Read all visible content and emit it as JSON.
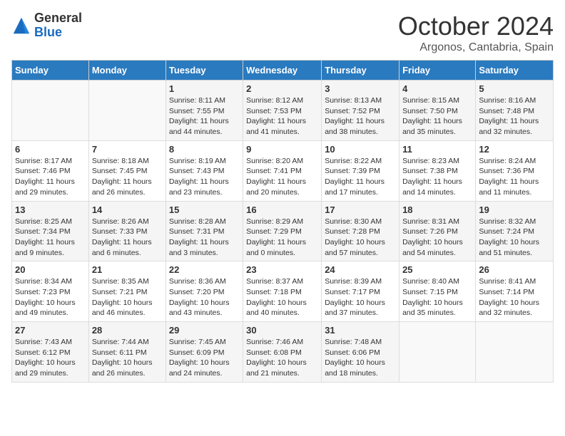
{
  "logo": {
    "general": "General",
    "blue": "Blue"
  },
  "title": "October 2024",
  "location": "Argonos, Cantabria, Spain",
  "days_of_week": [
    "Sunday",
    "Monday",
    "Tuesday",
    "Wednesday",
    "Thursday",
    "Friday",
    "Saturday"
  ],
  "weeks": [
    [
      {
        "day": "",
        "info": ""
      },
      {
        "day": "",
        "info": ""
      },
      {
        "day": "1",
        "info": "Sunrise: 8:11 AM\nSunset: 7:55 PM\nDaylight: 11 hours and 44 minutes."
      },
      {
        "day": "2",
        "info": "Sunrise: 8:12 AM\nSunset: 7:53 PM\nDaylight: 11 hours and 41 minutes."
      },
      {
        "day": "3",
        "info": "Sunrise: 8:13 AM\nSunset: 7:52 PM\nDaylight: 11 hours and 38 minutes."
      },
      {
        "day": "4",
        "info": "Sunrise: 8:15 AM\nSunset: 7:50 PM\nDaylight: 11 hours and 35 minutes."
      },
      {
        "day": "5",
        "info": "Sunrise: 8:16 AM\nSunset: 7:48 PM\nDaylight: 11 hours and 32 minutes."
      }
    ],
    [
      {
        "day": "6",
        "info": "Sunrise: 8:17 AM\nSunset: 7:46 PM\nDaylight: 11 hours and 29 minutes."
      },
      {
        "day": "7",
        "info": "Sunrise: 8:18 AM\nSunset: 7:45 PM\nDaylight: 11 hours and 26 minutes."
      },
      {
        "day": "8",
        "info": "Sunrise: 8:19 AM\nSunset: 7:43 PM\nDaylight: 11 hours and 23 minutes."
      },
      {
        "day": "9",
        "info": "Sunrise: 8:20 AM\nSunset: 7:41 PM\nDaylight: 11 hours and 20 minutes."
      },
      {
        "day": "10",
        "info": "Sunrise: 8:22 AM\nSunset: 7:39 PM\nDaylight: 11 hours and 17 minutes."
      },
      {
        "day": "11",
        "info": "Sunrise: 8:23 AM\nSunset: 7:38 PM\nDaylight: 11 hours and 14 minutes."
      },
      {
        "day": "12",
        "info": "Sunrise: 8:24 AM\nSunset: 7:36 PM\nDaylight: 11 hours and 11 minutes."
      }
    ],
    [
      {
        "day": "13",
        "info": "Sunrise: 8:25 AM\nSunset: 7:34 PM\nDaylight: 11 hours and 9 minutes."
      },
      {
        "day": "14",
        "info": "Sunrise: 8:26 AM\nSunset: 7:33 PM\nDaylight: 11 hours and 6 minutes."
      },
      {
        "day": "15",
        "info": "Sunrise: 8:28 AM\nSunset: 7:31 PM\nDaylight: 11 hours and 3 minutes."
      },
      {
        "day": "16",
        "info": "Sunrise: 8:29 AM\nSunset: 7:29 PM\nDaylight: 11 hours and 0 minutes."
      },
      {
        "day": "17",
        "info": "Sunrise: 8:30 AM\nSunset: 7:28 PM\nDaylight: 10 hours and 57 minutes."
      },
      {
        "day": "18",
        "info": "Sunrise: 8:31 AM\nSunset: 7:26 PM\nDaylight: 10 hours and 54 minutes."
      },
      {
        "day": "19",
        "info": "Sunrise: 8:32 AM\nSunset: 7:24 PM\nDaylight: 10 hours and 51 minutes."
      }
    ],
    [
      {
        "day": "20",
        "info": "Sunrise: 8:34 AM\nSunset: 7:23 PM\nDaylight: 10 hours and 49 minutes."
      },
      {
        "day": "21",
        "info": "Sunrise: 8:35 AM\nSunset: 7:21 PM\nDaylight: 10 hours and 46 minutes."
      },
      {
        "day": "22",
        "info": "Sunrise: 8:36 AM\nSunset: 7:20 PM\nDaylight: 10 hours and 43 minutes."
      },
      {
        "day": "23",
        "info": "Sunrise: 8:37 AM\nSunset: 7:18 PM\nDaylight: 10 hours and 40 minutes."
      },
      {
        "day": "24",
        "info": "Sunrise: 8:39 AM\nSunset: 7:17 PM\nDaylight: 10 hours and 37 minutes."
      },
      {
        "day": "25",
        "info": "Sunrise: 8:40 AM\nSunset: 7:15 PM\nDaylight: 10 hours and 35 minutes."
      },
      {
        "day": "26",
        "info": "Sunrise: 8:41 AM\nSunset: 7:14 PM\nDaylight: 10 hours and 32 minutes."
      }
    ],
    [
      {
        "day": "27",
        "info": "Sunrise: 7:43 AM\nSunset: 6:12 PM\nDaylight: 10 hours and 29 minutes."
      },
      {
        "day": "28",
        "info": "Sunrise: 7:44 AM\nSunset: 6:11 PM\nDaylight: 10 hours and 26 minutes."
      },
      {
        "day": "29",
        "info": "Sunrise: 7:45 AM\nSunset: 6:09 PM\nDaylight: 10 hours and 24 minutes."
      },
      {
        "day": "30",
        "info": "Sunrise: 7:46 AM\nSunset: 6:08 PM\nDaylight: 10 hours and 21 minutes."
      },
      {
        "day": "31",
        "info": "Sunrise: 7:48 AM\nSunset: 6:06 PM\nDaylight: 10 hours and 18 minutes."
      },
      {
        "day": "",
        "info": ""
      },
      {
        "day": "",
        "info": ""
      }
    ]
  ]
}
